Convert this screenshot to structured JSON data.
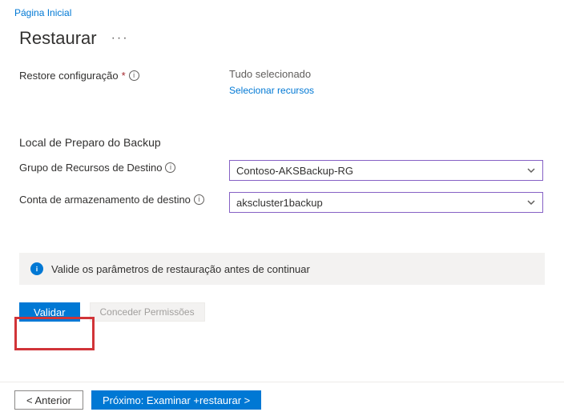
{
  "breadcrumb": {
    "home": "Página Inicial"
  },
  "header": {
    "title": "Restaurar"
  },
  "restoreConfig": {
    "label": "Restore configuração",
    "status": "Tudo selecionado",
    "selectLink": "Selecionar recursos"
  },
  "staging": {
    "sectionTitle": "Local de Preparo do Backup",
    "resourceGroupLabel": "Grupo de Recursos de Destino",
    "resourceGroupValue": "Contoso-AKSBackup-RG",
    "storageAccountLabel": "Conta de armazenamento de destino",
    "storageAccountValue": "akscluster1backup"
  },
  "banner": {
    "text": "Valide os parâmetros de restauração antes de continuar"
  },
  "buttons": {
    "validate": "Validar",
    "grant": "Conceder Permissões",
    "previous": "<  Anterior",
    "next": "Próximo: Examinar +restaurar >"
  }
}
